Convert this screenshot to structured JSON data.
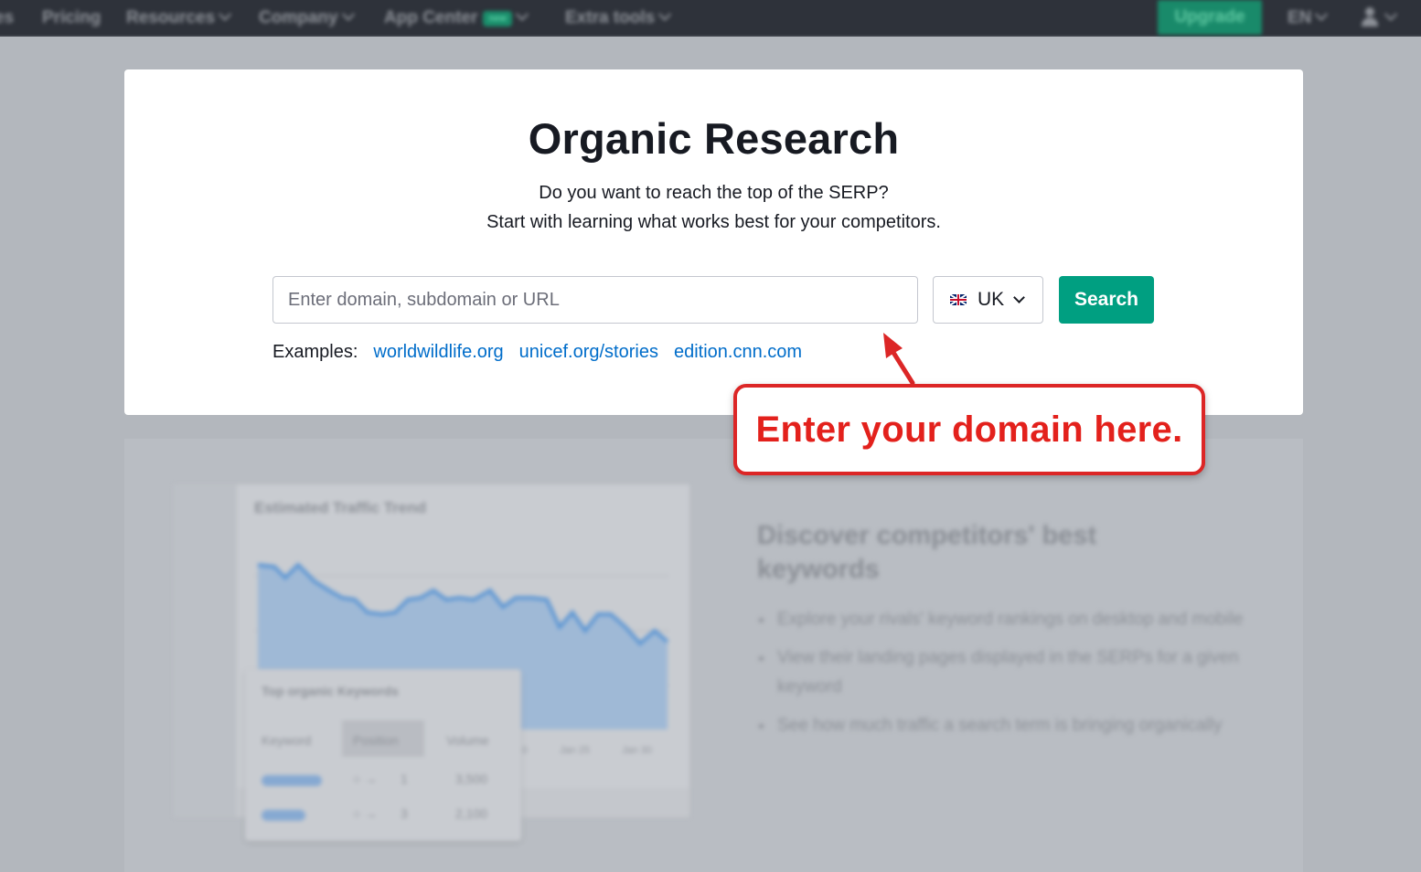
{
  "nav": {
    "items": [
      {
        "label": "es"
      },
      {
        "label": "Pricing"
      },
      {
        "label": "Resources"
      },
      {
        "label": "Company"
      },
      {
        "label": "App Center"
      },
      {
        "label": "Extra tools"
      }
    ],
    "new_badge": "new",
    "upgrade_label": "Upgrade",
    "language": "EN",
    "user_icon": "user-icon"
  },
  "search_card": {
    "title": "Organic Research",
    "subtitle_line1": "Do you want to reach the top of the SERP?",
    "subtitle_line2": "Start with learning what works best for your competitors.",
    "input_placeholder": "Enter domain, subdomain or URL",
    "input_value": "",
    "database": "UK",
    "search_label": "Search",
    "examples_label": "Examples:",
    "examples": [
      "worldwildlife.org",
      "unicef.org/stories",
      "edition.cnn.com"
    ]
  },
  "annotation": {
    "text": "Enter your domain here.",
    "color": "#e3211c"
  },
  "preview": {
    "chart_title": "Estimated Traffic Trend",
    "x_labels": [
      "Jan 20",
      "Jan 25",
      "Jan 30"
    ],
    "keywords_title": "Top organic Keywords",
    "keywords_columns": [
      "Keyword",
      "Position",
      "Volume"
    ],
    "keywords_rows": [
      {
        "position": "1",
        "volume": "3,500"
      },
      {
        "position": "3",
        "volume": "2,100"
      }
    ],
    "promo_title": "Discover competitors' best keywords",
    "promo_points": [
      "Explore your rivals' keyword rankings on desktop and mobile",
      "View their landing pages displayed in the SERPs for a given keyword",
      "See how much traffic a search term is bringing organically"
    ]
  },
  "colors": {
    "brand_green": "#009f81",
    "link_blue": "#006dca",
    "nav_bg": "#2e323a"
  }
}
